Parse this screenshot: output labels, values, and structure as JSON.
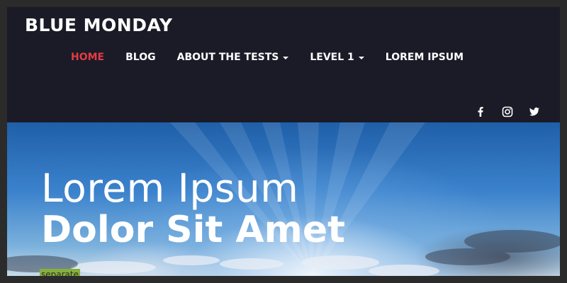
{
  "site": {
    "title": "BLUE MONDAY"
  },
  "nav": {
    "items": [
      {
        "label": "HOME",
        "active": true,
        "dropdown": false
      },
      {
        "label": "BLOG",
        "active": false,
        "dropdown": false
      },
      {
        "label": "ABOUT THE TESTS",
        "active": false,
        "dropdown": true
      },
      {
        "label": "LEVEL 1",
        "active": false,
        "dropdown": true
      },
      {
        "label": "LOREM IPSUM",
        "active": false,
        "dropdown": false
      }
    ],
    "active_color": "#e23c44"
  },
  "social": {
    "icons": [
      "facebook-icon",
      "instagram-icon",
      "twitter-icon"
    ]
  },
  "hero": {
    "line1": "Lorem Ipsum",
    "line2": "Dolor Sit Amet",
    "tag": "separate"
  },
  "colors": {
    "header_bg": "#1b1a27",
    "tag_bg": "#86b03c"
  }
}
